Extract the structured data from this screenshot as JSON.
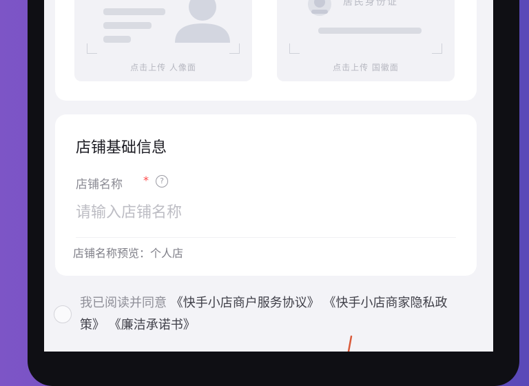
{
  "upload": {
    "portrait_caption": "点击上传 人像面",
    "emblem_caption": "点击上传 国徽面",
    "emblem_card_text": "居民身份证"
  },
  "shop_info": {
    "section_title": "店铺基础信息",
    "name_label": "店铺名称",
    "required_mark": "*",
    "help_symbol": "?",
    "name_placeholder": "请输入店铺名称",
    "name_value": "",
    "preview_text": "店铺名称预览：个人店"
  },
  "agreement": {
    "prefix": "我已阅读并同意",
    "link1": "《快手小店商户服务协议》",
    "link2": "《快手小店商家隐私政策》",
    "link3": "《廉洁承诺书》",
    "checked": false
  },
  "colors": {
    "background": "#6b4fc0",
    "annotation_arrow": "#d95a3a",
    "required": "#ff4a4a"
  }
}
